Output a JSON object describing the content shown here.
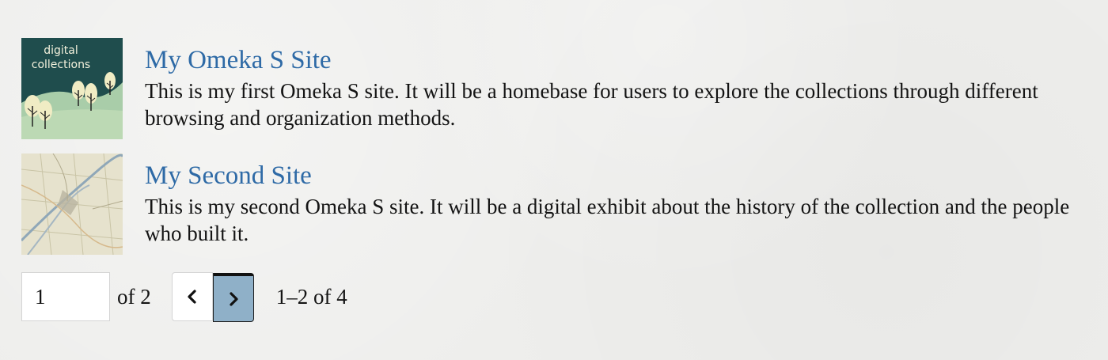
{
  "sites": [
    {
      "title": "My Omeka S Site",
      "description": "This is my first Omeka S site. It will be a homebase for users to explore the collections through different browsing and organization methods.",
      "thumbnail_text": [
        "digital",
        "collections"
      ]
    },
    {
      "title": "My Second Site",
      "description": "This is my second Omeka S site. It will be a digital exhibit about the history of the collection and the people who built it."
    }
  ],
  "pagination": {
    "current_page": "1",
    "of_total": "of 2",
    "range": "1–2 of 4"
  },
  "colors": {
    "link": "#2e6aa6",
    "next_button": "#8fb0c8",
    "thumbnail_bg": "#1f4d4d"
  }
}
